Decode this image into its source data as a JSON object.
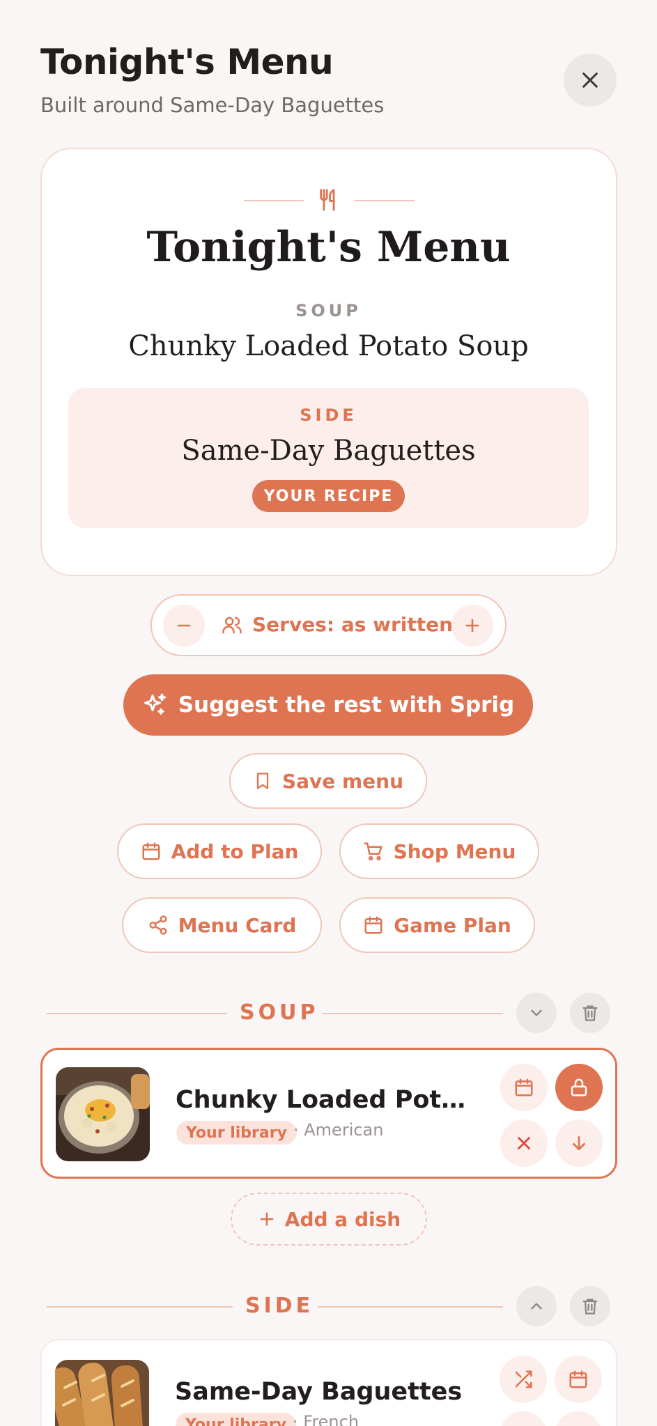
{
  "header": {
    "title": "Tonight's Menu",
    "subtitle": "Built around Same-Day Baguettes"
  },
  "card": {
    "title": "Tonight's Menu",
    "soup_label": "SOUP",
    "soup_name": "Chunky Loaded Potato Soup",
    "side_label": "SIDE",
    "side_name": "Same-Day Baguettes",
    "side_badge": "YOUR RECIPE"
  },
  "serves": {
    "label": "Serves: as written"
  },
  "actions": {
    "suggest": "Suggest the rest with Sprig",
    "save": "Save menu",
    "add_to_plan": "Add to Plan",
    "shop_menu": "Shop Menu",
    "menu_card": "Menu Card",
    "game_plan": "Game Plan"
  },
  "sections": [
    {
      "label": "SOUP",
      "dish": {
        "name": "Chunky Loaded Potato...",
        "tag": "Your library",
        "cuisine": "· American"
      },
      "add_dish": "Add a dish"
    },
    {
      "label": "SIDE",
      "dish": {
        "name": "Same-Day Baguettes",
        "tag": "Your library",
        "cuisine": "· French"
      }
    }
  ],
  "colors": {
    "accent": "#de7452",
    "accent_soft": "#fbeeeb",
    "background": "#f9f6f5"
  }
}
